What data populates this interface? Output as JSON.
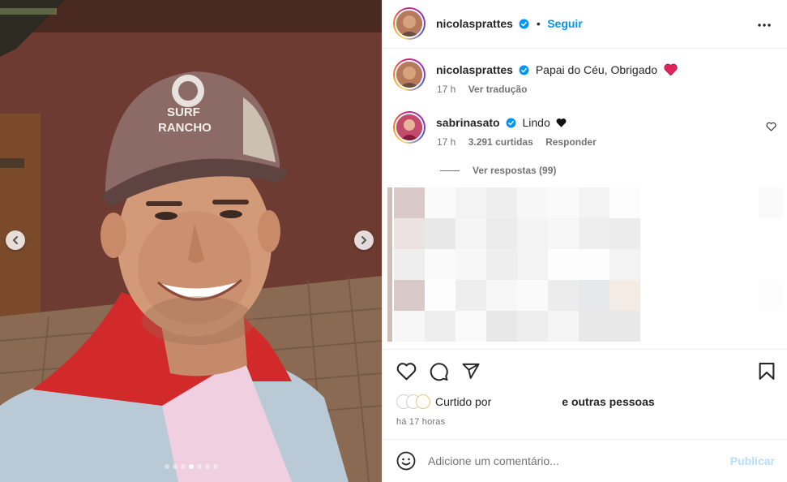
{
  "post": {
    "author": "nicolasprattes",
    "follow_label": "Seguir",
    "separator": "•",
    "caption": {
      "username": "nicolasprattes",
      "text": "Papai do Céu, Obrigado",
      "time": "17 h",
      "translate_label": "Ver tradução"
    },
    "comments": [
      {
        "username": "sabrinasato",
        "text": "Lindo",
        "time": "17 h",
        "likes": "3.291 curtidas",
        "reply_label": "Responder",
        "view_replies": "Ver respostas (99)"
      }
    ],
    "liked_by_label": "Curtido por",
    "liked_by_others": "e outras pessoas",
    "posted_ago": "há 17 horas",
    "comment_placeholder": "Adicione um comentário...",
    "publish_label": "Publicar"
  },
  "carousel": {
    "slide_count": 7,
    "active_index": 3,
    "cap_text": [
      "SURF",
      "RANCHO"
    ]
  },
  "icons": {
    "nav": [
      "chevron-left-icon",
      "chevron-right-icon"
    ],
    "actions": [
      "heart-icon",
      "comment-icon",
      "share-icon",
      "bookmark-icon"
    ],
    "misc": [
      "more-icon",
      "verified-icon",
      "emoji-icon",
      "red-heart-emoji",
      "black-heart-emoji"
    ]
  },
  "colors": {
    "accent": "#0095f6",
    "verified": "#0095f6",
    "publish_disabled": "#b2dffc",
    "muted_text": "#737373",
    "heart_red": "#e0245e",
    "jacket_red": "#d22a2a"
  }
}
